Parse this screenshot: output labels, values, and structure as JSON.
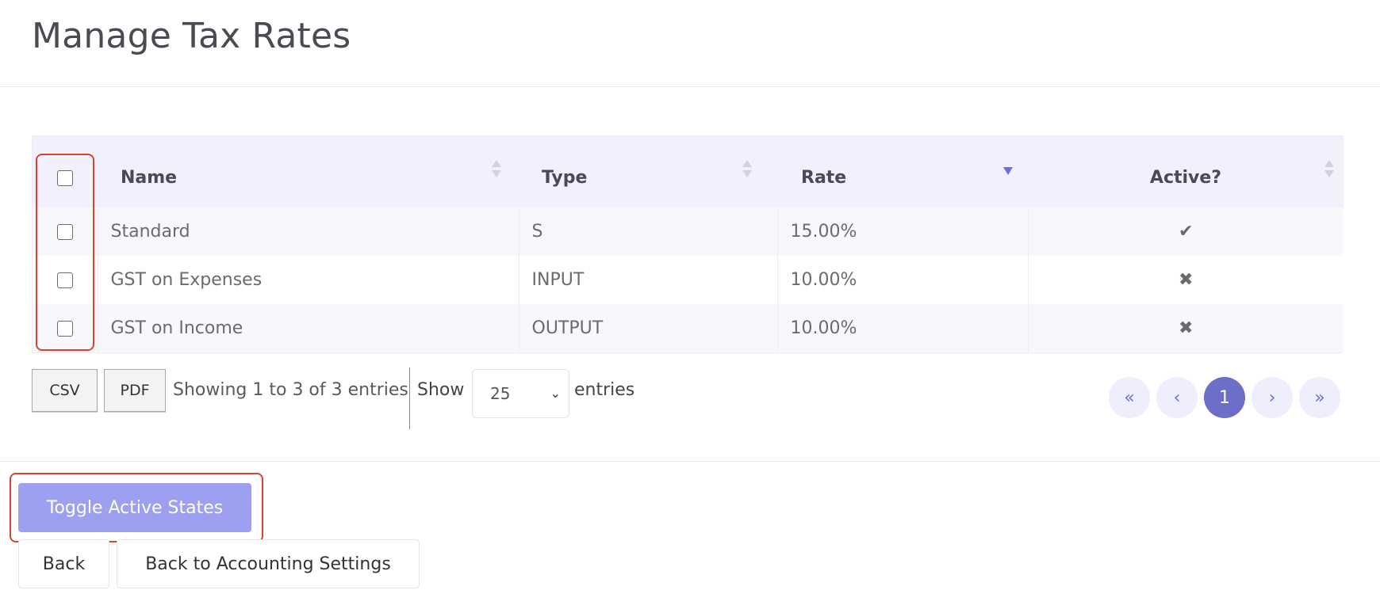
{
  "page": {
    "title": "Manage Tax Rates"
  },
  "table": {
    "columns": {
      "name": "Name",
      "type": "Type",
      "rate": "Rate",
      "active": "Active?"
    },
    "rows": [
      {
        "name": "Standard",
        "type": "S",
        "rate": "15.00%",
        "active": "✔",
        "active_state": true
      },
      {
        "name": "GST on Expenses",
        "type": "INPUT",
        "rate": "10.00%",
        "active": "✖",
        "active_state": false
      },
      {
        "name": "GST on Income",
        "type": "OUTPUT",
        "rate": "10.00%",
        "active": "✖",
        "active_state": false
      }
    ],
    "sorted_column": "rate",
    "sort_direction": "descending"
  },
  "controls": {
    "csv_label": "CSV",
    "pdf_label": "PDF",
    "info_text": "Showing 1 to 3 of 3 entries",
    "show_label": "Show",
    "page_length": "25",
    "entries_label": "entries"
  },
  "pagination": {
    "first": "«",
    "prev": "‹",
    "current": "1",
    "next": "›",
    "last": "»"
  },
  "footer": {
    "toggle_label": "Toggle Active States",
    "back_label": "Back",
    "back_settings_label": "Back to Accounting Settings"
  },
  "colors": {
    "accent": "#6c6ee6",
    "toggle_button": "#9d9ff0",
    "header_bg": "#f1f1fd",
    "highlight": "#d9432f"
  },
  "icons": {
    "active_true": "check-icon",
    "active_false": "cross-icon",
    "sort": "sort-icon",
    "dropdown": "chevron-down-icon"
  }
}
